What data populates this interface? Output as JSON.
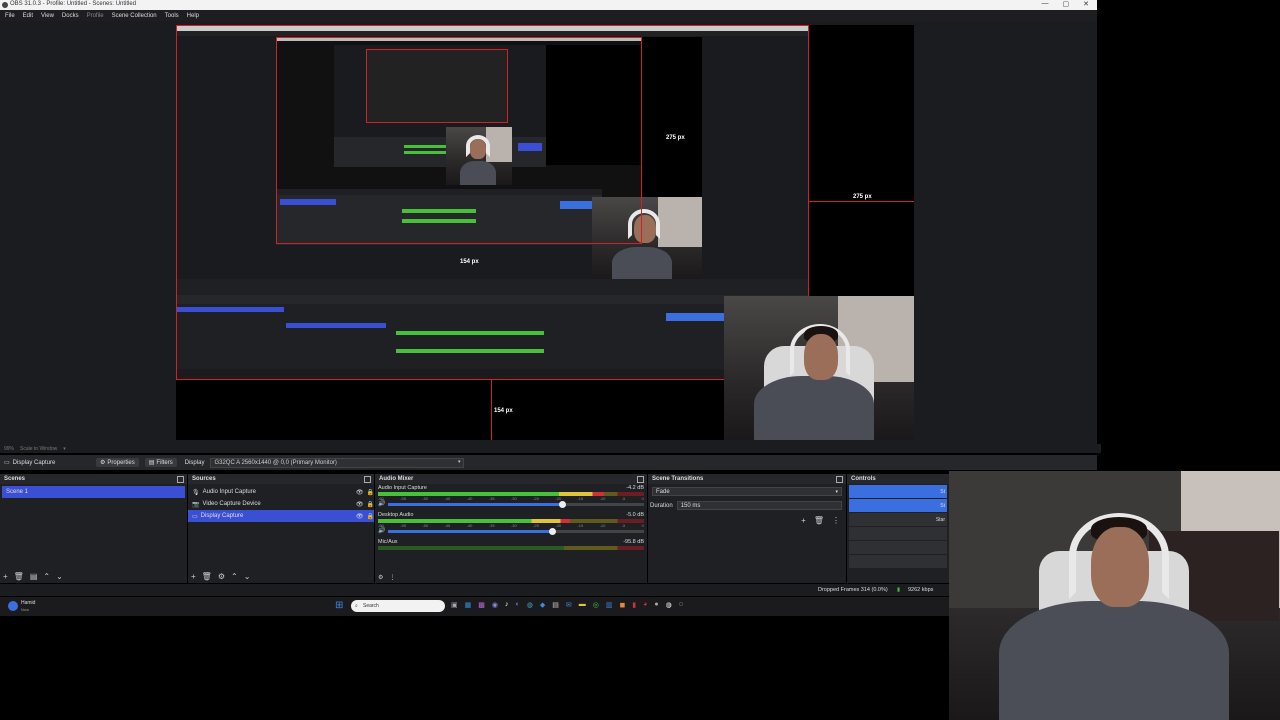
{
  "window": {
    "title": "OBS 31.0.3 - Profile: Untitled - Scenes: Untitled",
    "controls": [
      "—",
      "▢",
      "✕"
    ]
  },
  "menu": [
    "File",
    "Edit",
    "View",
    "Docks",
    "Profile",
    "Scene Collection",
    "Tools",
    "Help"
  ],
  "preview": {
    "measure_right": "275 px",
    "measure_bottom": "154 px",
    "zoom_level": "99%",
    "zoom_mode": "Scale to Window"
  },
  "context_bar": {
    "source_name": "Display Capture",
    "properties_label": "Properties",
    "filters_label": "Filters",
    "display_label": "Display",
    "display_value": "G32QC A 2560x1440 @ 0,0 (Primary Monitor)"
  },
  "scenes": {
    "title": "Scenes",
    "items": [
      "Scene 1"
    ]
  },
  "sources": {
    "title": "Sources",
    "items": [
      {
        "label": "Audio Input Capture",
        "icon": "mic-icon"
      },
      {
        "label": "Video Capture Device",
        "icon": "camera-icon"
      },
      {
        "label": "Display Capture",
        "icon": "monitor-icon"
      }
    ]
  },
  "mixer": {
    "title": "Audio Mixer",
    "channels": [
      {
        "name": "Audio Input Capture",
        "db": "-4.2 dB",
        "level": 0.85,
        "volume": 0.68
      },
      {
        "name": "Desktop Audio",
        "db": "-5.0 dB",
        "level": 0.72,
        "volume": 0.64
      },
      {
        "name": "Mic/Aux",
        "db": "-95.8 dB",
        "level": 0.0,
        "volume": 0.0
      }
    ],
    "ticks": [
      "-60",
      "-55",
      "-50",
      "-45",
      "-40",
      "-35",
      "-30",
      "-25",
      "-20",
      "-15",
      "-10",
      "-5",
      "0"
    ]
  },
  "transitions": {
    "title": "Scene Transitions",
    "type": "Fade",
    "duration_label": "Duration",
    "duration_value": "150 ms"
  },
  "controls": {
    "title": "Controls",
    "buttons": [
      "St",
      "St",
      "Star",
      "",
      "",
      ""
    ]
  },
  "status": {
    "dropped": "Dropped Frames 314 (0.0%)",
    "kbps": "9262 kbps"
  },
  "taskbar": {
    "user": "Hamid",
    "user_sub": "Now",
    "search": "Search"
  },
  "colors": {
    "accent": "#3b4fd4",
    "red_guide": "#d0202a",
    "bg": "#1f2023"
  }
}
